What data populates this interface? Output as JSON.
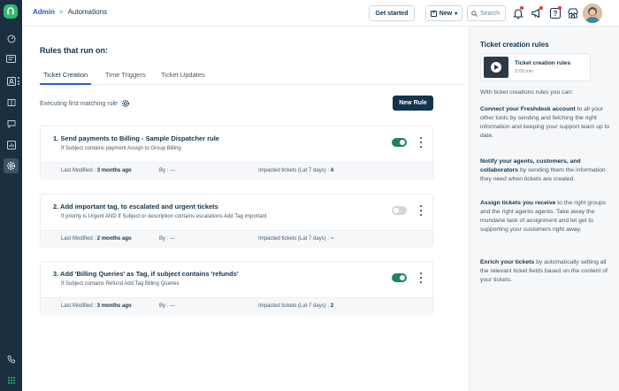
{
  "breadcrumb": {
    "parent": "Admin",
    "separator": ">",
    "current": "Automations"
  },
  "header": {
    "get_started": "Get started",
    "new_label": "New",
    "new_plus": "+",
    "new_chevron": "▾",
    "search_placeholder": "Search"
  },
  "main": {
    "title": "Rules that run on:",
    "tabs": [
      {
        "label": "Ticket Creation",
        "active": true
      },
      {
        "label": "Time Triggers",
        "active": false
      },
      {
        "label": "Ticket Updates",
        "active": false
      }
    ],
    "executing_label": "Executing first matching rule",
    "new_rule_button": "New Rule"
  },
  "rules": [
    {
      "title": "1. Send payments to Billing - Sample Dispatcher rule",
      "desc": "If Subject contains payment Assign to Group Billing",
      "enabled": true,
      "last_modified_label": "Last Modified :",
      "last_modified": "3 months ago",
      "by_label": "By :",
      "by": "---",
      "impacted_label": "Impacted tickets (Lat 7 days) :",
      "impacted": "4"
    },
    {
      "title": "2. Add important tag, to escalated and urgent tickets",
      "desc": "If priority is Urgent AND If Subject or description contains escalations Add Tag important",
      "enabled": false,
      "last_modified_label": "Last Modified :",
      "last_modified": "2 months ago",
      "by_label": "By :",
      "by": "---",
      "impacted_label": "Impacted tickets (Lat 7 days) :",
      "impacted": "--"
    },
    {
      "title": "3. Add 'Billing Queries' as Tag, if subject contains 'refunds'",
      "desc": "If Subject contains Refund Add Tag Billing Queries",
      "enabled": true,
      "last_modified_label": "Last Modified :",
      "last_modified": "3 months ago",
      "by_label": "By :",
      "by": "---",
      "impacted_label": "Impacted tickets (Lat 7 days) :",
      "impacted": "2"
    }
  ],
  "panel": {
    "title": "Ticket creation rules",
    "video_title": "Ticket creation rules",
    "video_duration": "2:03 min",
    "intro": "With ticket creations rules you can:",
    "items": [
      {
        "bold": "Connect your Freshdesk account",
        "rest": " to all your other tools by sending and fetching the right information and keeping your support team up to date."
      },
      {
        "bold": "Notify your agents, customers, and collaborators",
        "rest": " by sending them the information they need when tickets are created."
      },
      {
        "bold": "Assign tickets you receive",
        "rest": " to the right groups and the right agents agents. Take away the mundane task of assignment and let get to supporting your customers right away."
      },
      {
        "bold": "Enrich your tickets",
        "rest": " by automatically setting all the relevant ticket fields based on the content of your tickets."
      }
    ]
  },
  "colors": {
    "accent": "#2c5cc5",
    "toggle_on": "#1e8267",
    "sidebar": "#1b2f41",
    "brand": "#2fba72"
  }
}
